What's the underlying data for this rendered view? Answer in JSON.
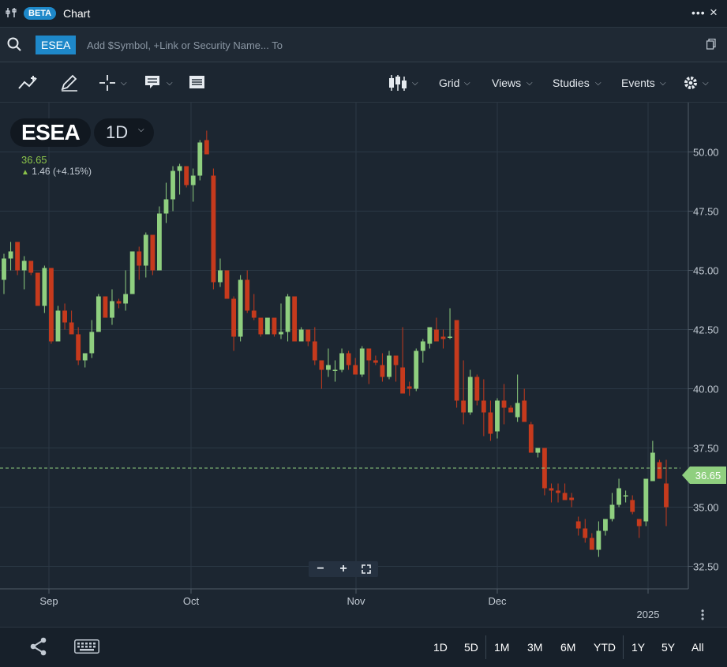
{
  "window": {
    "badge": "BETA",
    "title": "Chart",
    "menu_icon": "more-horizontal-icon",
    "close_label": "×"
  },
  "search": {
    "symbol": "ESEA",
    "placeholder": "Add $Symbol, +Link or Security Name... To"
  },
  "toolbar": {
    "grid_label": "Grid",
    "views_label": "Views",
    "studies_label": "Studies",
    "events_label": "Events"
  },
  "legend": {
    "symbol": "ESEA",
    "interval": "1D",
    "last": "36.65",
    "change": "1.46 (+4.15%)"
  },
  "price_tag": "36.65",
  "zoom": {
    "minus": "−",
    "plus": "+"
  },
  "ranges": [
    "1D",
    "5D",
    "1M",
    "3M",
    "6M",
    "YTD",
    "1Y",
    "5Y",
    "All"
  ],
  "colors": {
    "up": "#8fcf7f",
    "down": "#c63a1d",
    "accent": "#1e88c9",
    "background": "#1c2631"
  },
  "chart_data": {
    "type": "candlestick",
    "y_ticks": [
      "50.00",
      "47.50",
      "45.00",
      "42.50",
      "40.00",
      "37.50",
      "35.00",
      "32.50"
    ],
    "ylim": [
      31.75,
      51.75
    ],
    "x_labels": [
      "Sep",
      "Oct",
      "Nov",
      "Dec",
      "2025"
    ],
    "last_price": 36.65,
    "candles": [
      [
        44.6,
        45.7,
        44.0,
        45.5
      ],
      [
        45.5,
        46.2,
        45.0,
        45.8
      ],
      [
        46.2,
        46.2,
        44.8,
        45.0
      ],
      [
        45.0,
        45.6,
        44.2,
        45.4
      ],
      [
        45.4,
        45.4,
        44.8,
        44.9
      ],
      [
        44.9,
        44.9,
        43.5,
        43.5
      ],
      [
        43.5,
        45.2,
        43.2,
        45.1
      ],
      [
        45.1,
        45.1,
        41.9,
        42.0
      ],
      [
        42.0,
        43.5,
        42.0,
        43.3
      ],
      [
        43.3,
        43.6,
        42.5,
        42.8
      ],
      [
        42.8,
        43.3,
        42.3,
        42.3
      ],
      [
        42.3,
        42.6,
        41.0,
        41.2
      ],
      [
        41.2,
        41.2,
        40.9,
        41.5
      ],
      [
        41.5,
        42.9,
        41.3,
        42.4
      ],
      [
        42.4,
        44.0,
        42.4,
        43.9
      ],
      [
        43.9,
        43.9,
        43.0,
        43.0
      ],
      [
        43.0,
        44.2,
        42.7,
        43.7
      ],
      [
        43.7,
        43.8,
        43.4,
        43.6
      ],
      [
        43.6,
        45.0,
        43.3,
        44.0
      ],
      [
        44.0,
        45.8,
        44.0,
        45.8
      ],
      [
        45.8,
        46.0,
        44.6,
        45.2
      ],
      [
        45.2,
        46.6,
        44.7,
        46.5
      ],
      [
        46.5,
        46.5,
        44.8,
        45.0
      ],
      [
        45.0,
        47.7,
        45.0,
        47.4
      ],
      [
        47.4,
        48.7,
        47.0,
        48.0
      ],
      [
        48.0,
        49.4,
        47.5,
        49.2
      ],
      [
        49.2,
        49.5,
        48.2,
        49.4
      ],
      [
        49.4,
        49.4,
        48.5,
        48.6
      ],
      [
        48.6,
        49.3,
        47.9,
        49.0
      ],
      [
        49.0,
        50.5,
        48.8,
        50.4
      ],
      [
        50.5,
        50.9,
        49.9,
        49.9
      ],
      [
        49.0,
        49.3,
        44.2,
        44.5
      ],
      [
        44.5,
        45.5,
        44.3,
        45.0
      ],
      [
        45.0,
        45.0,
        43.8,
        43.8
      ],
      [
        43.8,
        43.9,
        41.6,
        42.2
      ],
      [
        42.2,
        44.8,
        42.0,
        44.6
      ],
      [
        44.6,
        45.0,
        43.2,
        43.3
      ],
      [
        43.3,
        44.0,
        42.9,
        43.0
      ],
      [
        43.0,
        43.0,
        42.2,
        42.3
      ],
      [
        42.3,
        43.0,
        42.3,
        43.0
      ],
      [
        43.0,
        43.0,
        42.2,
        42.3
      ],
      [
        42.3,
        43.6,
        42.1,
        42.4
      ],
      [
        42.4,
        44.0,
        42.0,
        43.9
      ],
      [
        43.9,
        43.9,
        42.0,
        42.0
      ],
      [
        42.0,
        42.6,
        42.0,
        42.5
      ],
      [
        42.5,
        42.5,
        41.8,
        42.0
      ],
      [
        42.0,
        42.6,
        41.0,
        41.2
      ],
      [
        41.2,
        41.2,
        40.0,
        40.8
      ],
      [
        40.8,
        41.7,
        40.5,
        41.0
      ],
      [
        40.8,
        41.2,
        40.3,
        40.8
      ],
      [
        40.8,
        41.7,
        40.7,
        41.5
      ],
      [
        41.5,
        41.6,
        40.8,
        41.0
      ],
      [
        41.0,
        41.3,
        40.6,
        40.6
      ],
      [
        40.6,
        41.8,
        40.5,
        41.7
      ],
      [
        41.7,
        41.7,
        40.2,
        41.2
      ],
      [
        41.2,
        41.4,
        41.0,
        41.1
      ],
      [
        41.0,
        41.5,
        40.3,
        40.5
      ],
      [
        40.5,
        41.6,
        40.4,
        41.4
      ],
      [
        41.4,
        41.4,
        40.3,
        41.0
      ],
      [
        40.9,
        42.6,
        39.8,
        39.8
      ],
      [
        40.1,
        40.3,
        39.7,
        40.0
      ],
      [
        40.0,
        41.7,
        39.9,
        41.6
      ],
      [
        41.6,
        42.1,
        41.1,
        42.0
      ],
      [
        41.9,
        42.5,
        41.7,
        42.6
      ],
      [
        42.5,
        43.0,
        42.3,
        42.0
      ],
      [
        42.2,
        42.5,
        41.7,
        42.1
      ],
      [
        42.2,
        43.4,
        42.1,
        42.2
      ],
      [
        42.9,
        42.9,
        39.2,
        39.5
      ],
      [
        39.5,
        41.2,
        38.5,
        39.0
      ],
      [
        39.0,
        40.8,
        38.9,
        40.5
      ],
      [
        40.5,
        40.6,
        39.3,
        39.5
      ],
      [
        39.5,
        40.4,
        38.0,
        39.0
      ],
      [
        39.0,
        39.5,
        37.8,
        38.1
      ],
      [
        38.2,
        39.6,
        37.9,
        39.5
      ],
      [
        39.5,
        40.2,
        38.5,
        39.2
      ],
      [
        39.2,
        39.3,
        39.0,
        39.0
      ],
      [
        38.8,
        40.6,
        38.6,
        39.4
      ],
      [
        39.5,
        40.0,
        39.0,
        38.6
      ],
      [
        38.5,
        38.6,
        37.3,
        37.3
      ],
      [
        37.3,
        37.5,
        37.1,
        37.5
      ],
      [
        37.5,
        37.5,
        35.5,
        35.8
      ],
      [
        35.8,
        36.0,
        35.2,
        35.7
      ],
      [
        35.7,
        36.0,
        35.2,
        35.6
      ],
      [
        35.6,
        36.0,
        35.3,
        35.3
      ],
      [
        35.4,
        35.6,
        35.0,
        35.3
      ],
      [
        34.4,
        34.6,
        33.8,
        34.1
      ],
      [
        34.1,
        34.5,
        33.5,
        33.7
      ],
      [
        33.7,
        33.9,
        33.2,
        33.2
      ],
      [
        33.2,
        34.4,
        32.9,
        34.0
      ],
      [
        34.0,
        34.5,
        33.8,
        34.5
      ],
      [
        34.5,
        35.6,
        34.4,
        35.1
      ],
      [
        35.1,
        36.2,
        35.0,
        35.8
      ],
      [
        35.5,
        35.7,
        35.2,
        35.5
      ],
      [
        35.3,
        35.5,
        34.7,
        34.8
      ],
      [
        34.5,
        34.5,
        33.7,
        34.2
      ],
      [
        34.4,
        36.2,
        34.2,
        36.2
      ],
      [
        36.1,
        37.8,
        36.3,
        37.3
      ],
      [
        36.9,
        37.0,
        36.2,
        36.2
      ],
      [
        36.0,
        37.0,
        34.2,
        35.0
      ]
    ]
  }
}
